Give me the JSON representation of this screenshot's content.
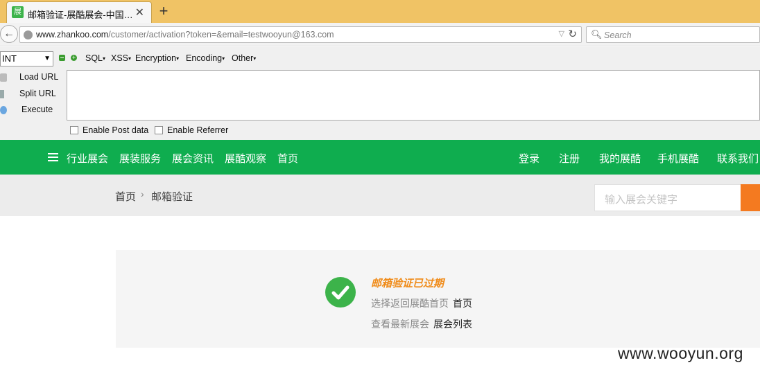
{
  "browser": {
    "tab_title": "邮箱验证-展酷展会-中国…",
    "tab_favicon": "展",
    "url_host": "www.zhankoo.com",
    "url_path": "/customer/activation?token=&email=testwooyun@163.com",
    "search_placeholder": "Search"
  },
  "hackbar": {
    "select_value": "INT",
    "menus": [
      "SQL",
      "XSS",
      "Encryption",
      "Encoding",
      "Other"
    ],
    "side": [
      "Load URL",
      "Split URL",
      "Execute"
    ],
    "checks": [
      "Enable Post data",
      "Enable Referrer"
    ]
  },
  "site": {
    "nav_left": [
      "行业展会",
      "展装服务",
      "展会资讯",
      "展酷观察",
      "首页"
    ],
    "nav_right": [
      "登录",
      "注册",
      "我的展酷",
      "手机展酷",
      "联系我们"
    ],
    "breadcrumb": {
      "home": "首页",
      "sep": "›",
      "current": "邮箱验证"
    },
    "search_placeholder": "输入展会关键字"
  },
  "message": {
    "title": "邮箱验证已过期",
    "line1_text": "选择返回展酷首页",
    "line1_link": "首页",
    "line2_text": "查看最新展会",
    "line2_link": "展会列表"
  },
  "watermark": "www.wooyun.org",
  "colors": {
    "brand_green": "#0fad4f",
    "accent_orange": "#f47a20",
    "title_orange": "#f08c1a"
  }
}
